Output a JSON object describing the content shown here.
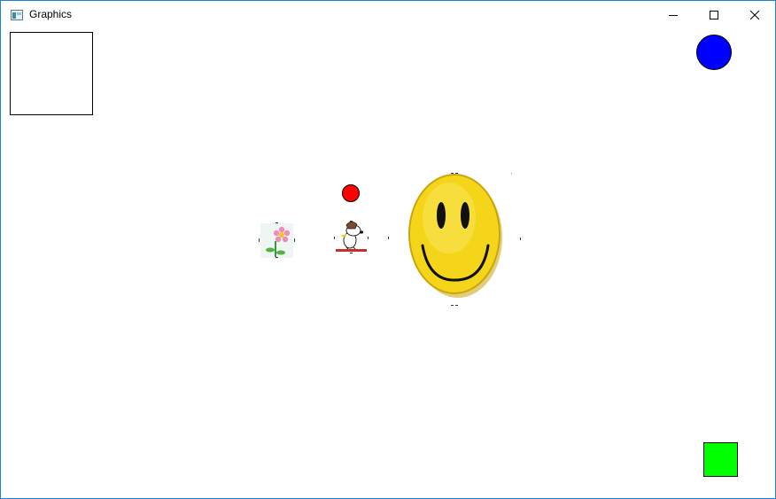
{
  "window": {
    "title": "Graphics",
    "accent_color": "#1883d7"
  },
  "title_controls": {
    "minimize_icon": "minimize-icon",
    "maximize_icon": "maximize-icon",
    "close_icon": "close-icon"
  },
  "canvas": {
    "shapes": {
      "outlined_square": {
        "fill": "#ffffff",
        "stroke": "#000000"
      },
      "blue_circle": {
        "fill": "#0000ff",
        "stroke": "#000000"
      },
      "green_square": {
        "fill": "#00ff00",
        "stroke": "#000000"
      },
      "red_circle": {
        "fill": "#ff0000",
        "stroke": "#000000"
      }
    },
    "sprites": {
      "flower": "flower-sprite",
      "snoopy": "snoopy-sprite",
      "smiley": "smiley-face-sprite",
      "smiley_color": "#f5d51a"
    }
  }
}
